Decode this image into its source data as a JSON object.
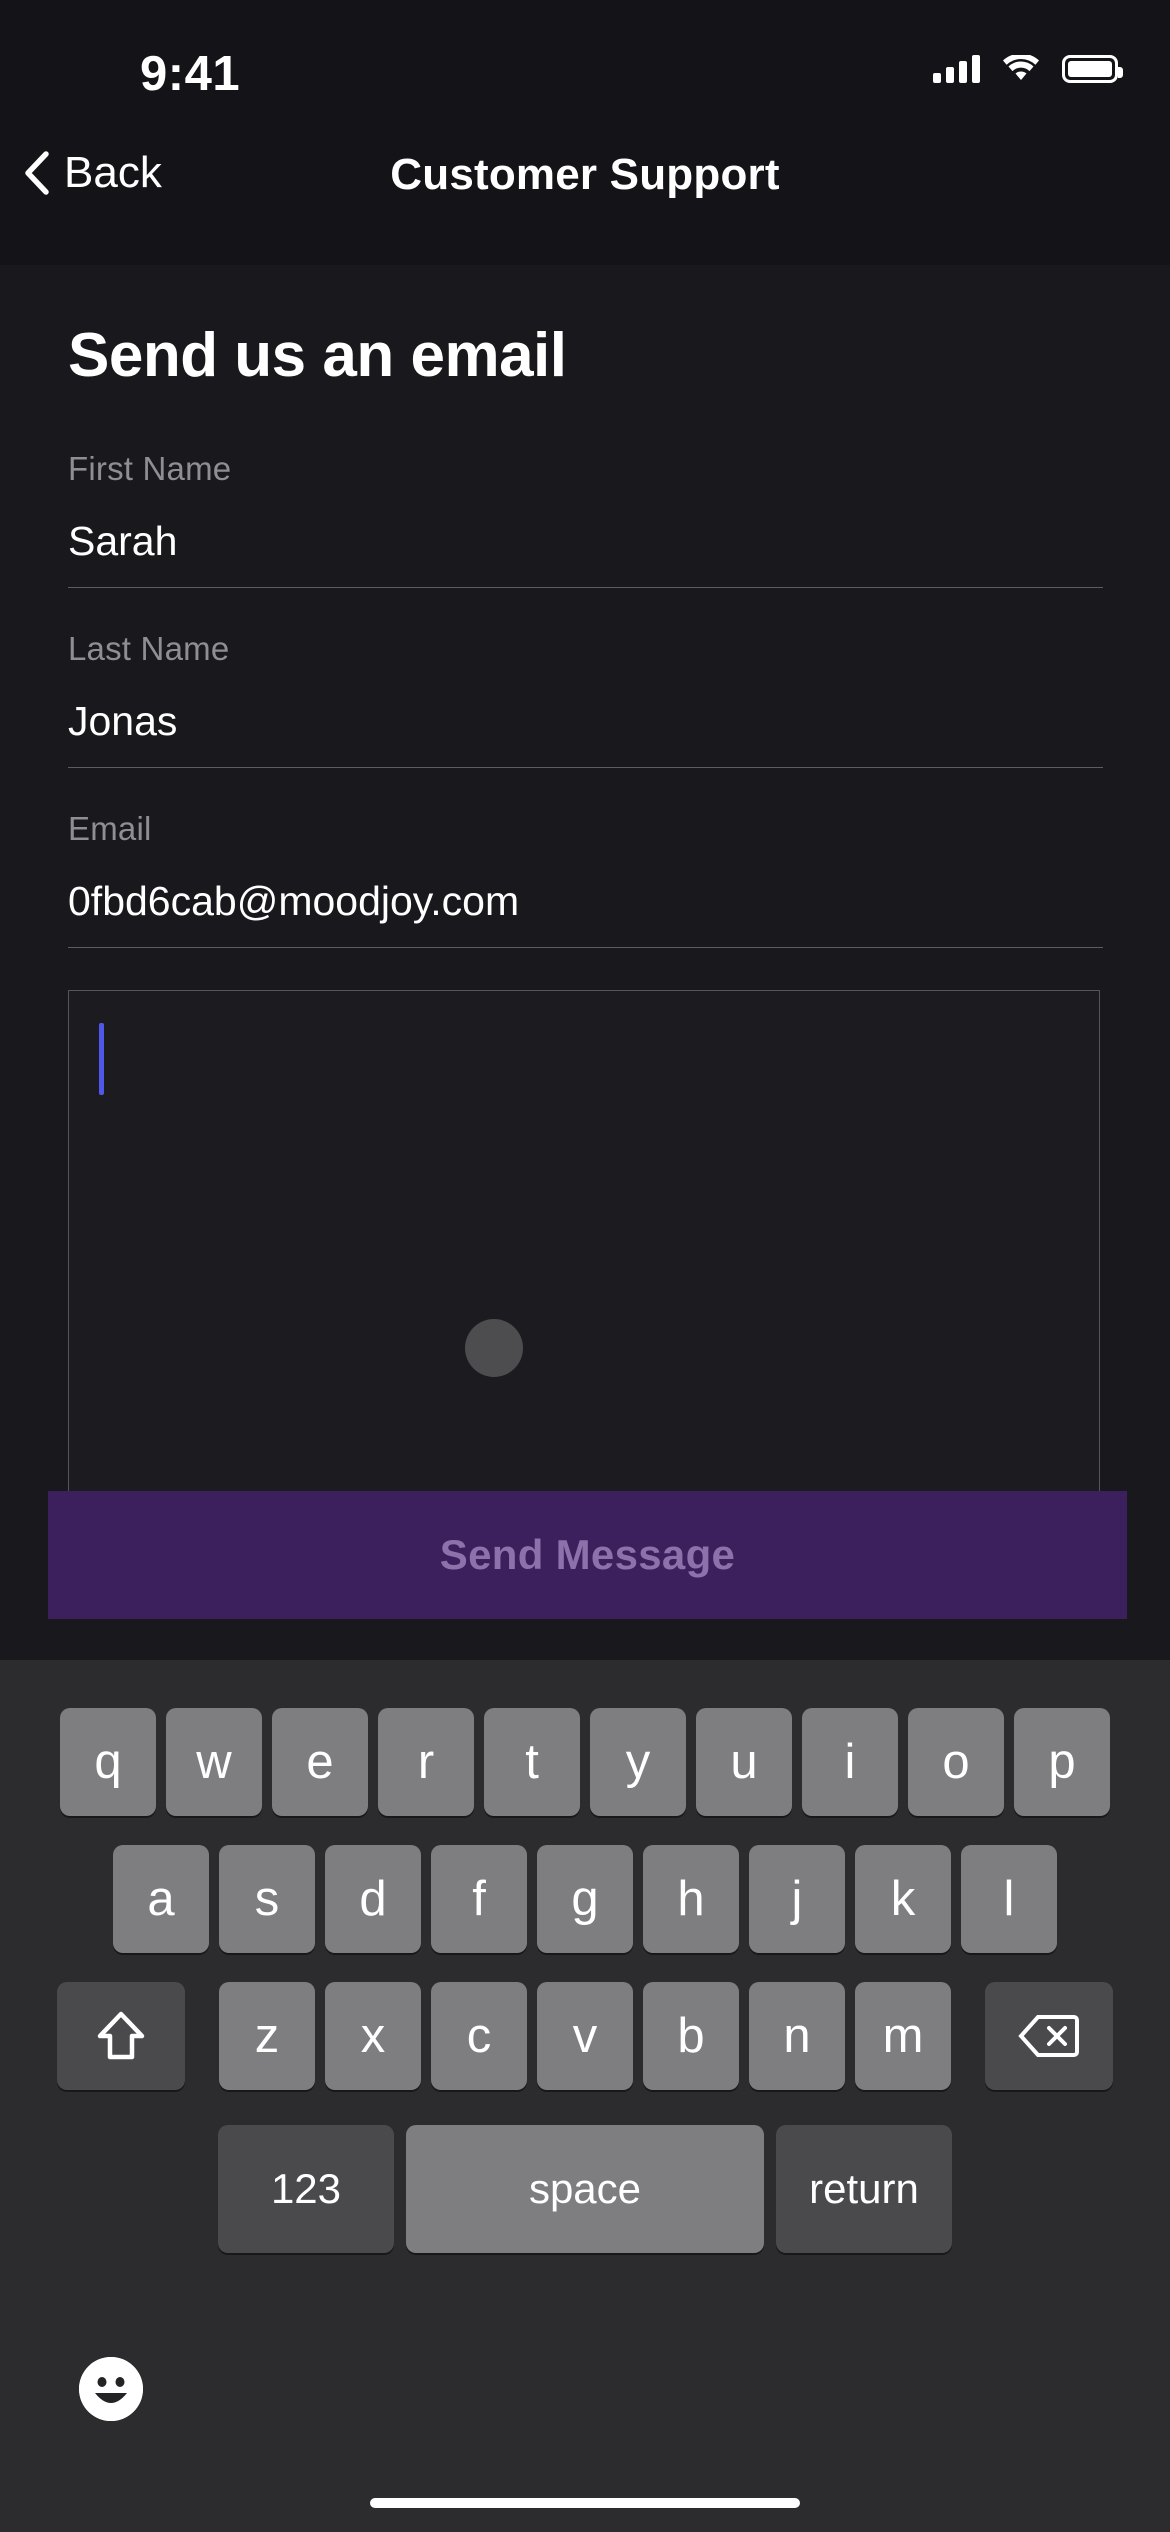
{
  "status_bar": {
    "time": "9:41",
    "cellular_icon": "cellular-signal-icon",
    "wifi_icon": "wifi-icon",
    "battery_icon": "battery-icon"
  },
  "nav_bar": {
    "back_label": "Back",
    "back_icon": "chevron-left-icon",
    "title": "Customer Support"
  },
  "main": {
    "heading": "Send us an email",
    "fields": [
      {
        "label": "First Name",
        "value": "Sarah"
      },
      {
        "label": "Last Name",
        "value": "Jonas"
      },
      {
        "label": "Email",
        "value": "0fbd6cab@moodjoy.com"
      }
    ],
    "message": {
      "value": "",
      "caret_color": "#4f58e8"
    },
    "send_button": {
      "label": "Send Message",
      "background": "#3c1f5d",
      "text_color": "#8c72ab"
    },
    "touch_indicator": {
      "color": "#4d4d50"
    }
  },
  "keyboard": {
    "row1": [
      "q",
      "w",
      "e",
      "r",
      "t",
      "y",
      "u",
      "i",
      "o",
      "p"
    ],
    "row2": [
      "a",
      "s",
      "d",
      "f",
      "g",
      "h",
      "j",
      "k",
      "l"
    ],
    "row3": [
      "z",
      "x",
      "c",
      "v",
      "b",
      "n",
      "m"
    ],
    "shift_icon": "shift-arrow-icon",
    "backspace_icon": "backspace-delete-icon",
    "numbers_label": "123",
    "space_label": "space",
    "return_label": "return",
    "emoji_icon": "smiley-face-icon"
  }
}
